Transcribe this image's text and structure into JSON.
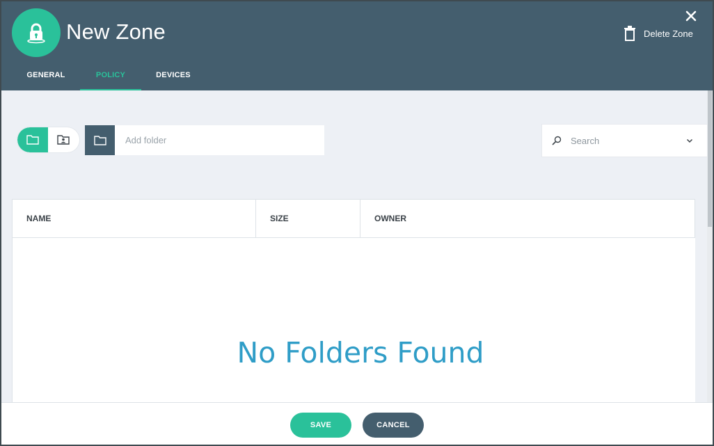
{
  "header": {
    "title": "New Zone",
    "delete_label": "Delete Zone",
    "avatar_icon": "lock-icon",
    "background": "#445e6e",
    "accent": "#2ac19a"
  },
  "tabs": [
    {
      "label": "GENERAL",
      "active": false
    },
    {
      "label": "POLICY",
      "active": true
    },
    {
      "label": "DEVICES",
      "active": false
    }
  ],
  "toolbar": {
    "folder_toggle_icon": "folder-icon",
    "user_folder_toggle_icon": "user-folder-icon",
    "add_folder_placeholder": "Add folder",
    "search_placeholder": "Search"
  },
  "table": {
    "columns": [
      "NAME",
      "SIZE",
      "OWNER"
    ],
    "rows": [],
    "empty_message": "No Folders Found"
  },
  "footer": {
    "save_label": "SAVE",
    "cancel_label": "CANCEL"
  }
}
